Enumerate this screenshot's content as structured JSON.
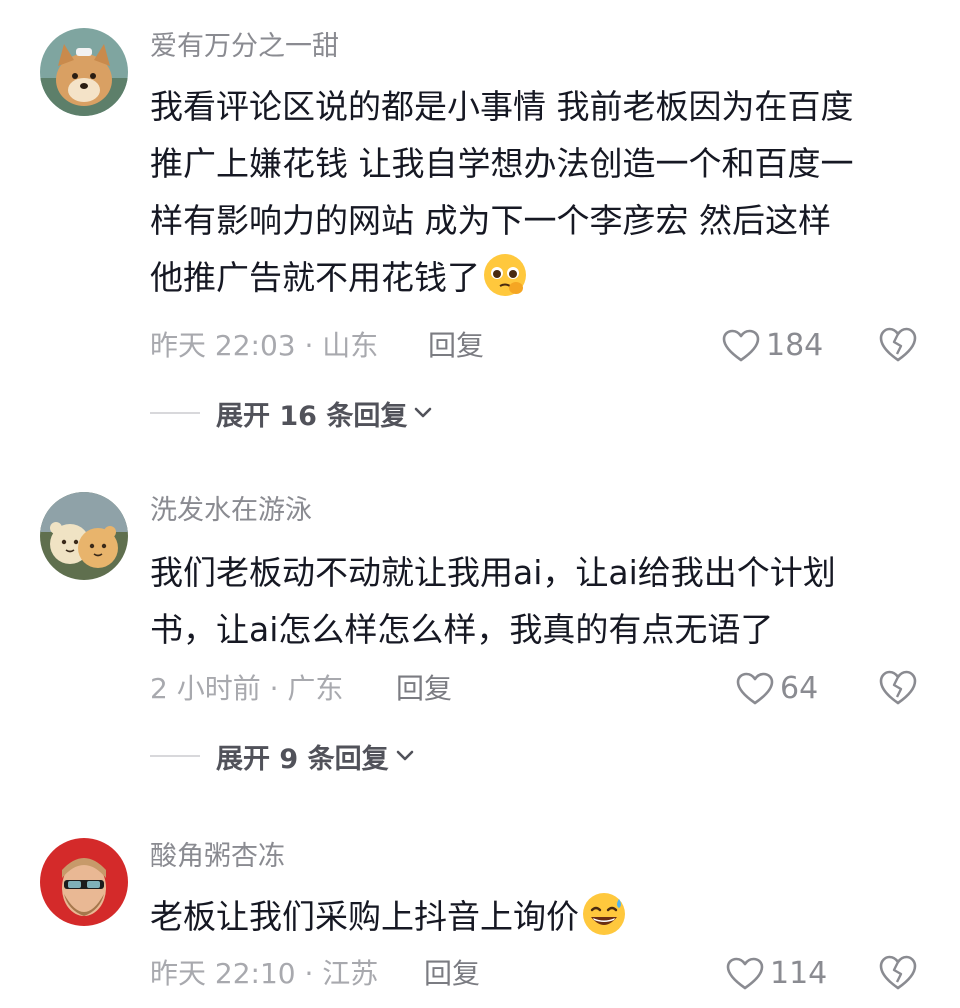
{
  "comments": [
    {
      "username": "爱有万分之一甜",
      "avatar_icon": "shiba-dog-avatar",
      "lines": [
        "我看评论区说的都是小事情 我前老板因为在百度",
        "推广上嫌花钱 让我自学想办法创造一个和百度一",
        "样有影响力的网站 成为下一个李彦宏 然后这样",
        "他推广告就不用花钱了"
      ],
      "emoji": "pleading-face-emoji",
      "meta": "昨天 22:03 · 山东",
      "reply_label": "回复",
      "likes": "184",
      "expand_label": "展开 16 条回复"
    },
    {
      "username": "洗发水在游泳",
      "avatar_icon": "bear-dolls-avatar",
      "lines": [
        "我们老板动不动就让我用ai，让ai给我出个计划",
        "书，让ai怎么样怎么样，我真的有点无语了"
      ],
      "meta": "2 小时前 · 广东",
      "reply_label": "回复",
      "likes": "64",
      "expand_label": "展开 9 条回复"
    },
    {
      "username": "酸角粥杏冻",
      "avatar_icon": "bearded-man-avatar",
      "lines": [
        "老板让我们采购上抖音上询价"
      ],
      "emoji": "grinning-sweat-emoji",
      "meta": "昨天 22:10 · 江苏",
      "reply_label": "回复",
      "likes": "114"
    }
  ],
  "colors": {
    "username": "#8a8b91",
    "text": "#161823",
    "meta": "#a8a9ae",
    "emoji_yellow": "#ffc83d"
  }
}
